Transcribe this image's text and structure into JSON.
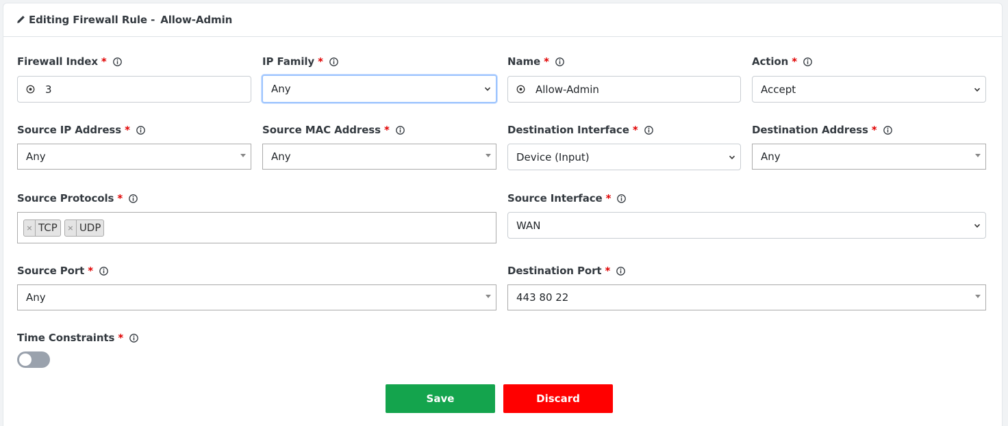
{
  "header": {
    "title_prefix": "Editing Firewall Rule -",
    "rule_name": "Allow-Admin"
  },
  "fields": {
    "firewall_index": {
      "label": "Firewall Index",
      "required": "*",
      "value": "3"
    },
    "ip_family": {
      "label": "IP Family",
      "required": "*",
      "value": "Any"
    },
    "name": {
      "label": "Name",
      "required": "*",
      "value": "Allow-Admin"
    },
    "action": {
      "label": "Action",
      "required": "*",
      "value": "Accept"
    },
    "source_ip": {
      "label": "Source IP Address",
      "required": "*",
      "value": "Any"
    },
    "source_mac": {
      "label": "Source MAC Address",
      "required": "*",
      "value": "Any"
    },
    "destination_interface": {
      "label": "Destination Interface",
      "required": "*",
      "value": "Device (Input)"
    },
    "destination_address": {
      "label": "Destination Address",
      "required": "*",
      "value": "Any"
    },
    "source_protocols": {
      "label": "Source Protocols",
      "required": "*",
      "tags": [
        "TCP",
        "UDP"
      ],
      "remove_glyph": "×"
    },
    "source_interface": {
      "label": "Source Interface",
      "required": "*",
      "value": "WAN"
    },
    "source_port": {
      "label": "Source Port",
      "required": "*",
      "value": "Any"
    },
    "destination_port": {
      "label": "Destination Port",
      "required": "*",
      "value": "443 80 22"
    },
    "time_constraints": {
      "label": "Time Constraints",
      "required": "*",
      "enabled": false
    }
  },
  "buttons": {
    "save": "Save",
    "discard": "Discard"
  },
  "colors": {
    "required": "#e00000",
    "save": "#14a44d",
    "discard": "#ff0000",
    "focus": "#9ec5fe",
    "toggle_off": "#9aa2ad"
  },
  "icons": {
    "header": "pencil-icon",
    "label_hint": "info-icon",
    "text_prefix": "target-icon",
    "select": "chevron-down-icon",
    "searchable_select": "caret-down-icon"
  }
}
